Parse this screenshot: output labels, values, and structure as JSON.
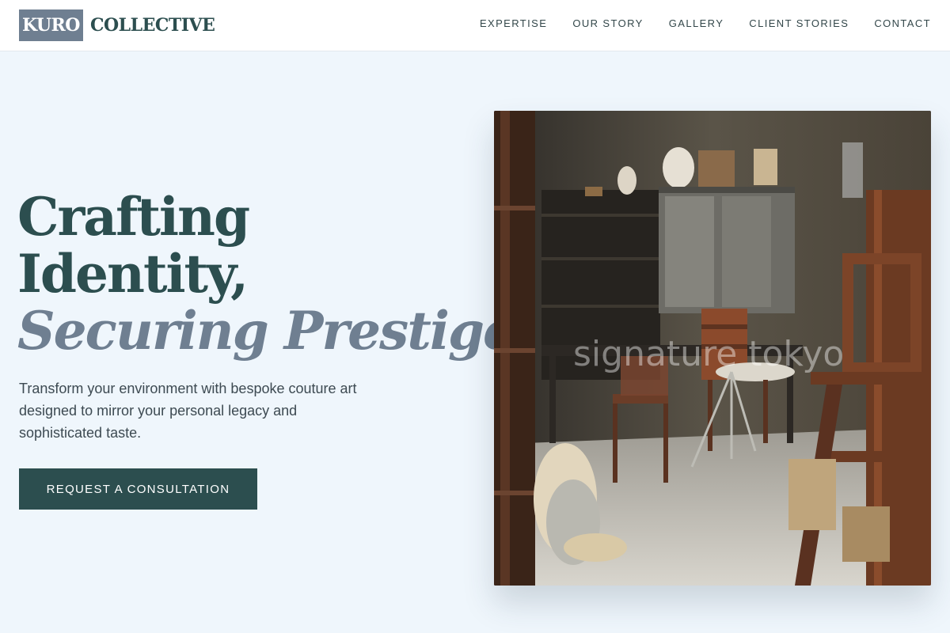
{
  "brand": {
    "box_text": "KURO",
    "name": "COLLECTIVE"
  },
  "nav": {
    "items": [
      {
        "label": "EXPERTISE"
      },
      {
        "label": "OUR STORY"
      },
      {
        "label": "GALLERY"
      },
      {
        "label": "CLIENT STORIES"
      },
      {
        "label": "CONTACT"
      }
    ]
  },
  "hero": {
    "title_line1": "Crafting",
    "title_line2": "Identity,",
    "title_line3": "Securing Prestige.",
    "subtitle": "Transform your environment with bespoke couture art designed to mirror your personal legacy and sophisticated taste.",
    "cta_label": "REQUEST A CONSULTATION"
  },
  "image": {
    "watermark": "signature tokyo"
  },
  "colors": {
    "primary": "#2c4e4f",
    "accent": "#6f7f91",
    "background": "#eff6fc"
  }
}
